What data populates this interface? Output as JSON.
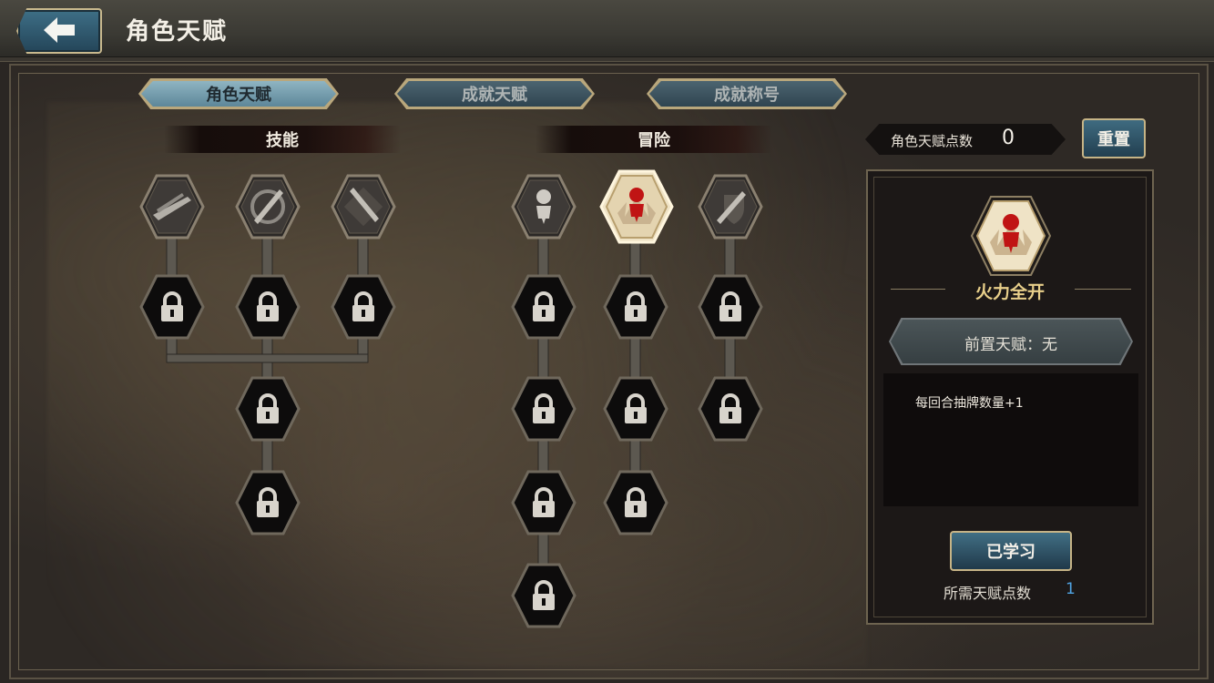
{
  "header": {
    "title": "角色天赋",
    "back_icon": "arrow-left-icon"
  },
  "tabs": [
    {
      "label": "角色天赋",
      "active": true
    },
    {
      "label": "成就天赋",
      "active": false
    },
    {
      "label": "成就称号",
      "active": false
    }
  ],
  "sections": {
    "skills": "技能",
    "adventure": "冒险"
  },
  "talent_points": {
    "label": "角色天赋点数",
    "value": "0"
  },
  "reset_button": "重置",
  "detail": {
    "name": "火力全开",
    "prerequisite": "前置天赋：无",
    "description": "每回合抽牌数量+1",
    "status_button": "已学习",
    "cost_label": "所需天赋点数",
    "cost_value": "1"
  },
  "nodes": {
    "skills": [
      {
        "icon": "sword-icon",
        "state": "unlocked"
      },
      {
        "icon": "slash-shield-icon",
        "state": "unlocked"
      },
      {
        "icon": "crossed-feather-icon",
        "state": "unlocked"
      },
      {
        "icon": "lock-icon",
        "state": "locked"
      },
      {
        "icon": "lock-icon",
        "state": "locked"
      },
      {
        "icon": "lock-icon",
        "state": "locked"
      },
      {
        "icon": "lock-icon",
        "state": "locked"
      },
      {
        "icon": "lock-icon",
        "state": "locked"
      }
    ],
    "adventure": [
      {
        "icon": "character-icon",
        "state": "unlocked"
      },
      {
        "icon": "fire-character-icon",
        "state": "selected"
      },
      {
        "icon": "sword-shield-icon",
        "state": "unlocked"
      },
      {
        "icon": "lock-icon",
        "state": "locked"
      },
      {
        "icon": "lock-icon",
        "state": "locked"
      },
      {
        "icon": "lock-icon",
        "state": "locked"
      },
      {
        "icon": "lock-icon",
        "state": "locked"
      },
      {
        "icon": "lock-icon",
        "state": "locked"
      },
      {
        "icon": "lock-icon",
        "state": "locked"
      },
      {
        "icon": "lock-icon",
        "state": "locked"
      },
      {
        "icon": "lock-icon",
        "state": "locked"
      },
      {
        "icon": "lock-icon",
        "state": "locked"
      }
    ]
  }
}
